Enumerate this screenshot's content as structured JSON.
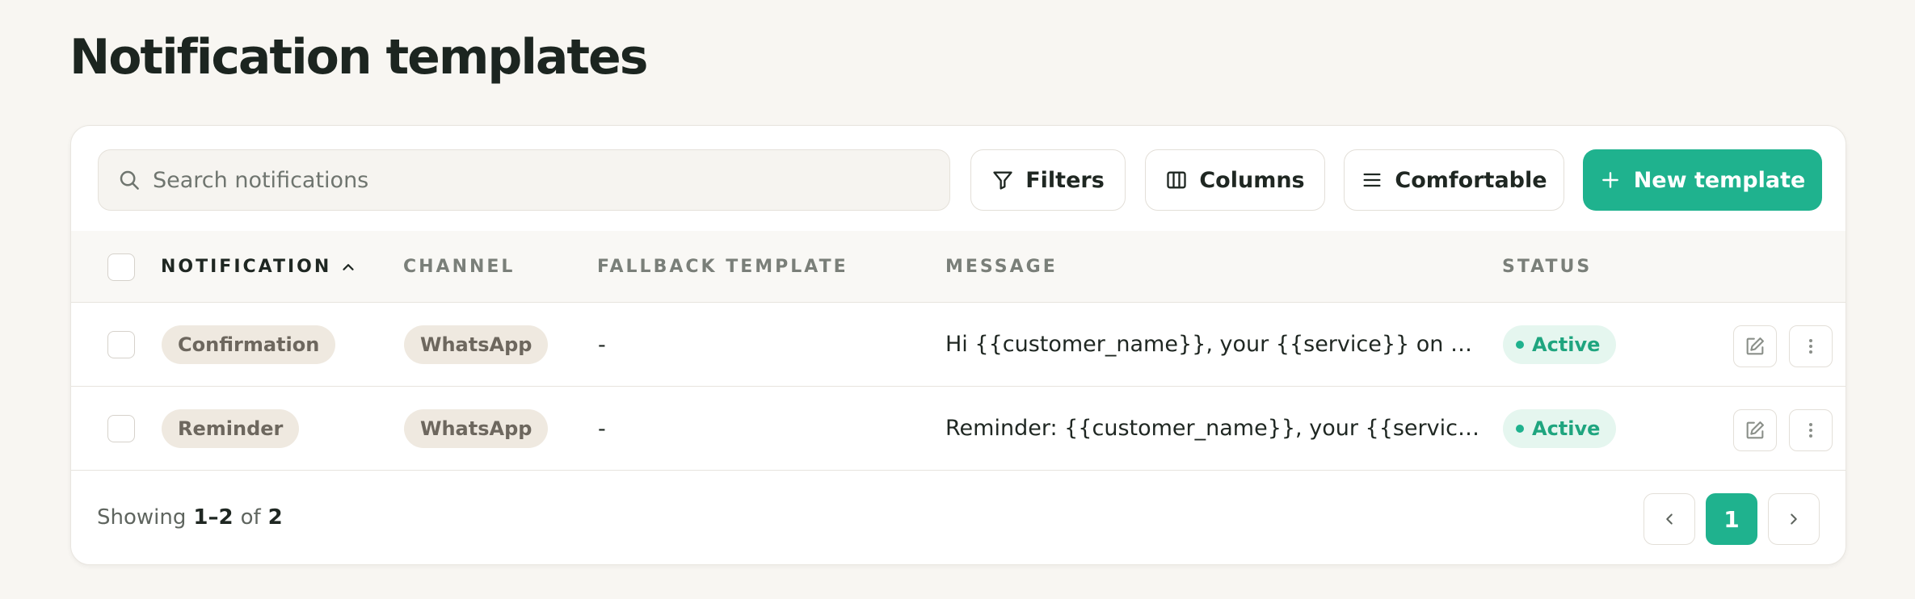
{
  "page": {
    "title": "Notification templates"
  },
  "toolbar": {
    "search_placeholder": "Search notifications",
    "filters_label": "Filters",
    "columns_label": "Columns",
    "density_label": "Comfortable",
    "new_label": "New template"
  },
  "table": {
    "columns": [
      "NOTIFICATION",
      "CHANNEL",
      "FALLBACK TEMPLATE",
      "MESSAGE",
      "STATUS"
    ],
    "sort": {
      "column": "NOTIFICATION",
      "direction": "ascending"
    },
    "rows": [
      {
        "notification": "Confirmation",
        "channel": "WhatsApp",
        "fallback": "-",
        "message": "Hi {{customer_name}}, your {{service}} on {{date}} is confirmed.",
        "status": "Active"
      },
      {
        "notification": "Reminder",
        "channel": "WhatsApp",
        "fallback": "-",
        "message": "Reminder: {{customer_name}}, your {{service}} is coming up.",
        "status": "Active"
      }
    ]
  },
  "footer": {
    "showing_prefix": "Showing",
    "range": "1–2",
    "of_label": "of",
    "total": "2",
    "current_page": "1"
  },
  "colors": {
    "accent": "#1fb28e",
    "background": "#f8f6f2",
    "chip_background": "#efe9e0",
    "status_background": "#e5f6ef"
  },
  "icons": [
    "search-icon",
    "filter-icon",
    "columns-icon",
    "density-icon",
    "plus-icon",
    "chevron-up-icon",
    "edit-icon",
    "more-vertical-icon",
    "chevron-left-icon",
    "chevron-right-icon"
  ]
}
